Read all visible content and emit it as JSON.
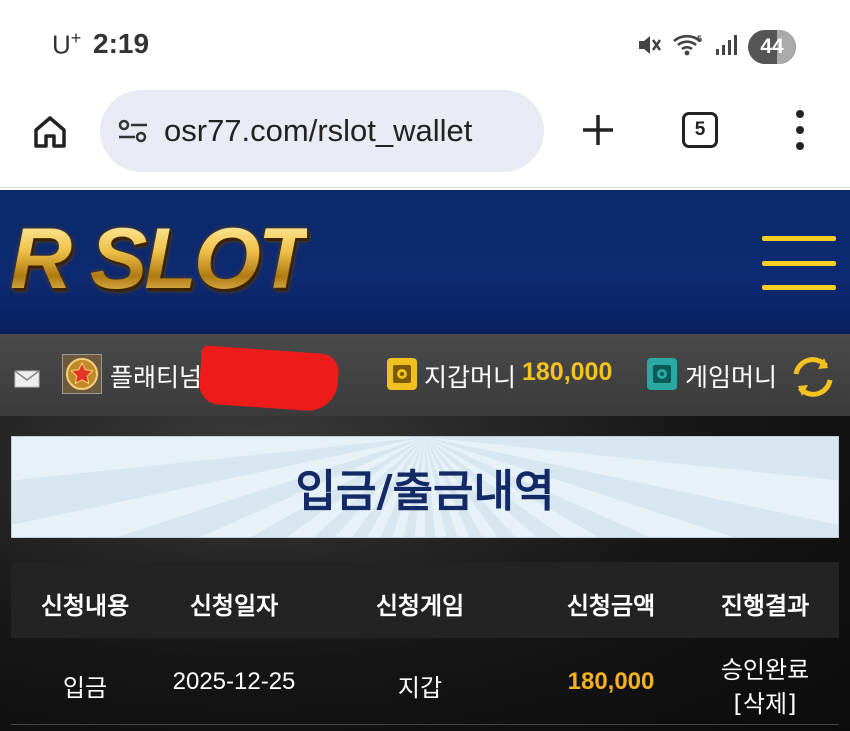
{
  "status_bar": {
    "carrier": "U",
    "carrier_sup": "+",
    "time": "2:19",
    "battery": "44",
    "icons": [
      "mute-icon",
      "wifi-icon",
      "signal-icon"
    ]
  },
  "browser": {
    "url": "osr77.com/rslot_wallet",
    "tab_count": "5",
    "icons": [
      "home-icon",
      "site-settings-icon",
      "new-tab-icon",
      "more-options-icon"
    ]
  },
  "site": {
    "logo": "R SLOT",
    "colors": {
      "header_bg": "#0e2a72",
      "accent": "#f5c21f",
      "title_text": "#132a66"
    }
  },
  "user_bar": {
    "grade": "플래티넘",
    "wallet_label": "지갑머니",
    "wallet_amount": "180,000",
    "game_label": "게임머니",
    "icons": [
      "mail-icon",
      "grade-badge-icon",
      "wallet-safe-icon",
      "game-safe-icon",
      "refresh-icon"
    ]
  },
  "page": {
    "title": "입금/출금내역"
  },
  "table": {
    "headers": [
      "신청내용",
      "신청일자",
      "신청게임",
      "신청금액",
      "진행결과"
    ],
    "rows": [
      {
        "type": "입금",
        "date": "2025-12-25",
        "game": "지갑",
        "amount": "180,000",
        "status": "승인완료",
        "action": "[삭제]"
      }
    ]
  }
}
